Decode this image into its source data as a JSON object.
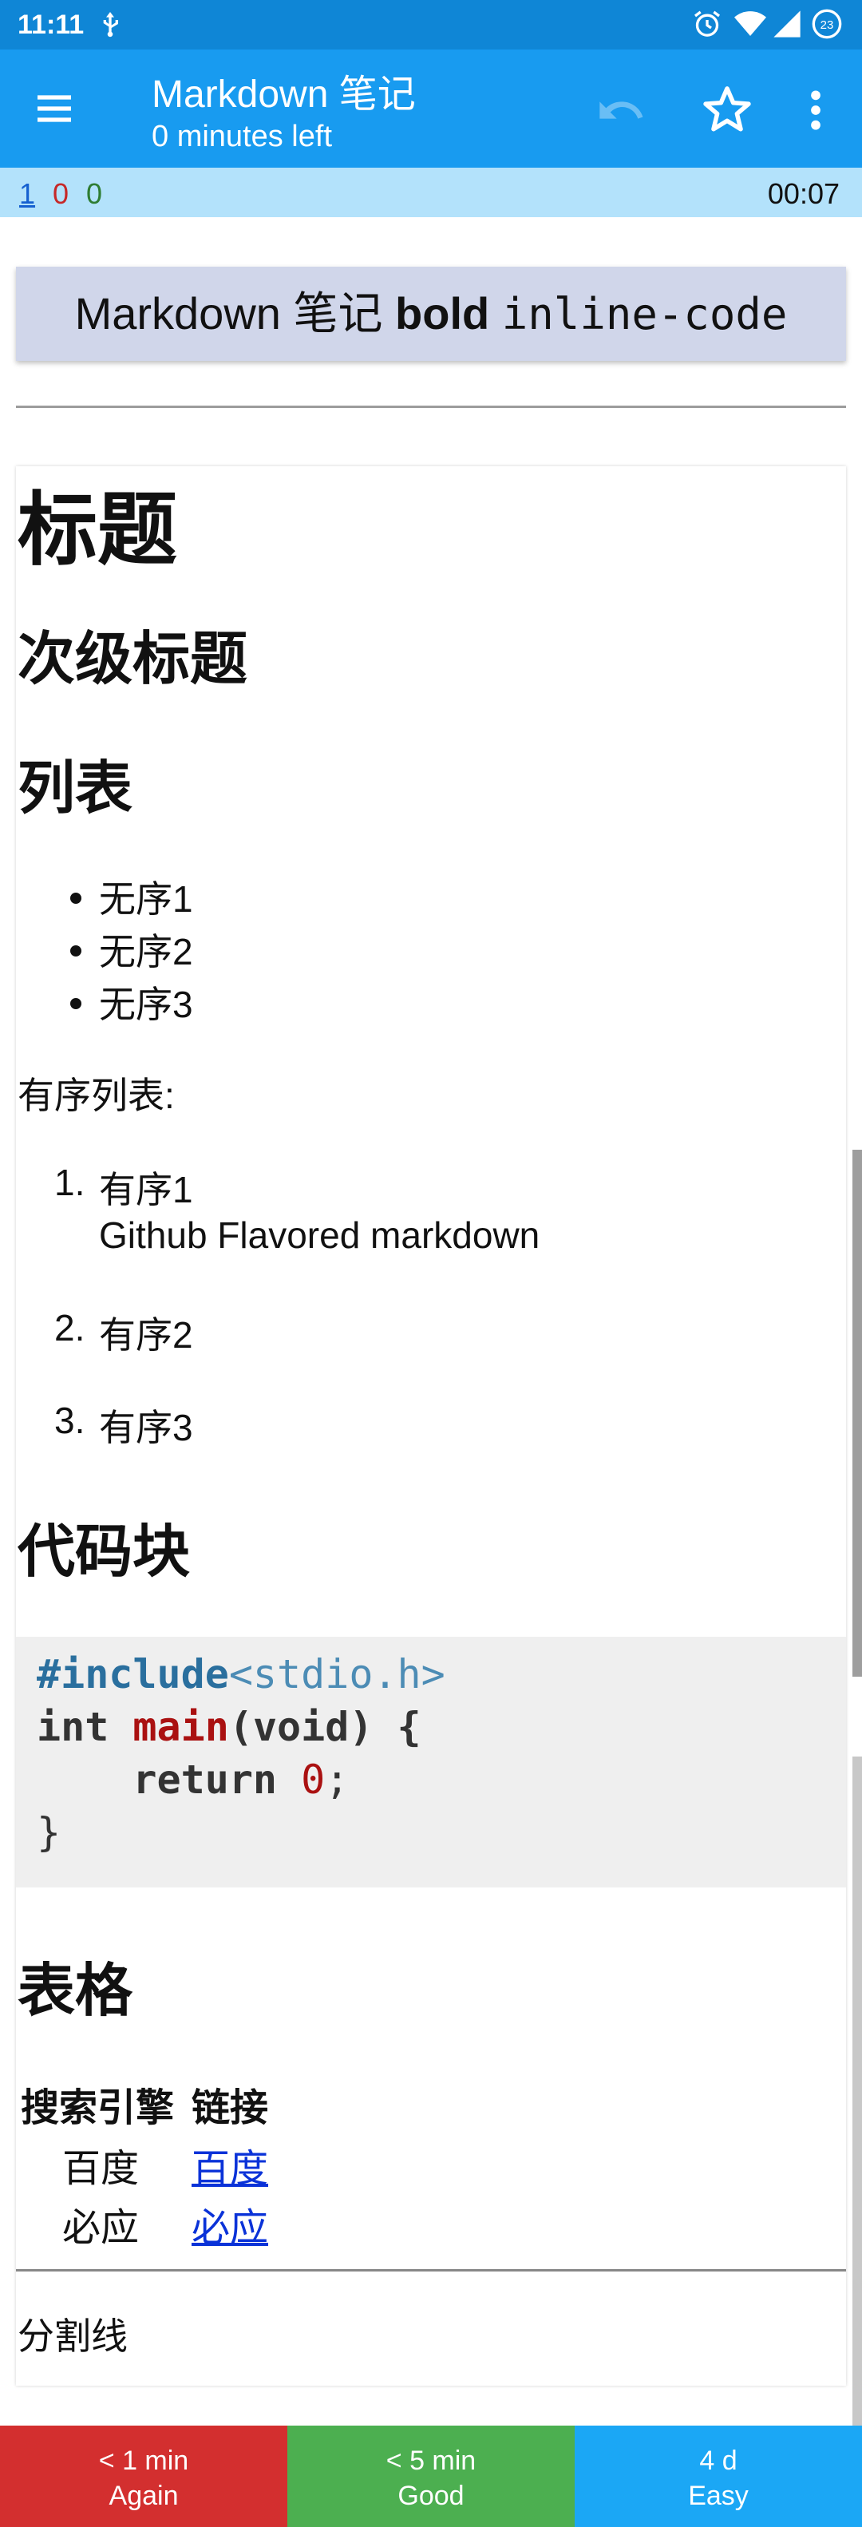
{
  "status_bar": {
    "time": "11:11",
    "notification_count": "23"
  },
  "toolbar": {
    "title": "Markdown 笔记",
    "subtitle": "0 minutes left"
  },
  "counts": {
    "new": "1",
    "learning": "0",
    "review": "0",
    "timer": "00:07"
  },
  "question": {
    "text": "Markdown 笔记 ",
    "bold": "bold",
    "code": "inline-code"
  },
  "answer": {
    "h1": "标题",
    "h2_sub": "次级标题",
    "h2_list": "列表",
    "unordered": [
      "无序1",
      "无序2",
      "无序3"
    ],
    "ordered_label": "有序列表:",
    "ordered": [
      {
        "num": "1.",
        "text": "有序1",
        "extra": "Github Flavored markdown"
      },
      {
        "num": "2.",
        "text": "有序2"
      },
      {
        "num": "3.",
        "text": "有序3"
      }
    ],
    "h2_code": "代码块",
    "code": {
      "l1_kw": "#include",
      "l1_inc": "<stdio.h>",
      "l2_type": "int ",
      "l2_fn": "main",
      "l2_rest": "(void) {",
      "l3_kw": "    return ",
      "l3_num": "0",
      "l3_end": ";",
      "l4": "}"
    },
    "h2_table": "表格",
    "table": {
      "headers": [
        "搜索引擎",
        "链接"
      ],
      "rows": [
        [
          "百度",
          "百度"
        ],
        [
          "必应",
          "必应"
        ]
      ]
    },
    "divider_label": "分割线"
  },
  "buttons": {
    "again": {
      "interval": "< 1 min",
      "label": "Again"
    },
    "good": {
      "interval": "< 5 min",
      "label": "Good"
    },
    "easy": {
      "interval": "4 d",
      "label": "Easy"
    }
  }
}
